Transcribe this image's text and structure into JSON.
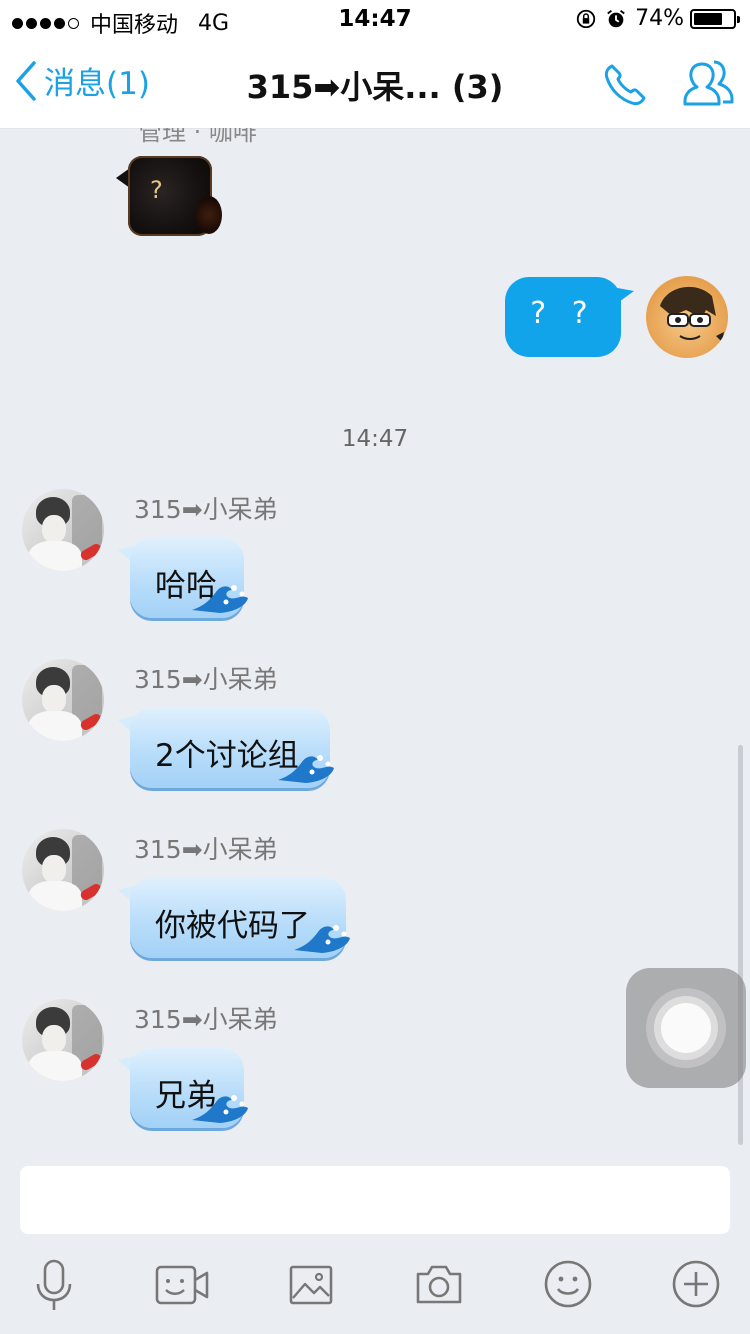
{
  "status_bar": {
    "carrier": "中国移动",
    "network": "4G",
    "time": "14:47",
    "battery": "74%",
    "battery_level": 0.74
  },
  "nav": {
    "back_label": "消息(1)",
    "title": "315➡小呆... (3)",
    "accent": "#1aa1e6"
  },
  "partial_top_name": "管理 · 咖啡",
  "sticker_text": "?",
  "my_message": "? ?",
  "timestamp": "14:47",
  "messages": [
    {
      "sender": "315➡小呆弟",
      "text": "哈哈"
    },
    {
      "sender": "315➡小呆弟",
      "text": "2个讨论组"
    },
    {
      "sender": "315➡小呆弟",
      "text": "你被代码了"
    },
    {
      "sender": "315➡小呆弟",
      "text": "兄弟"
    }
  ],
  "input": {
    "value": "",
    "placeholder": ""
  },
  "toolbar_icons": [
    "microphone-icon",
    "video-icon",
    "image-icon",
    "camera-icon",
    "emoji-icon",
    "plus-icon"
  ],
  "colors": {
    "my_bubble": "#12a4ea",
    "background": "#eaedf2"
  }
}
